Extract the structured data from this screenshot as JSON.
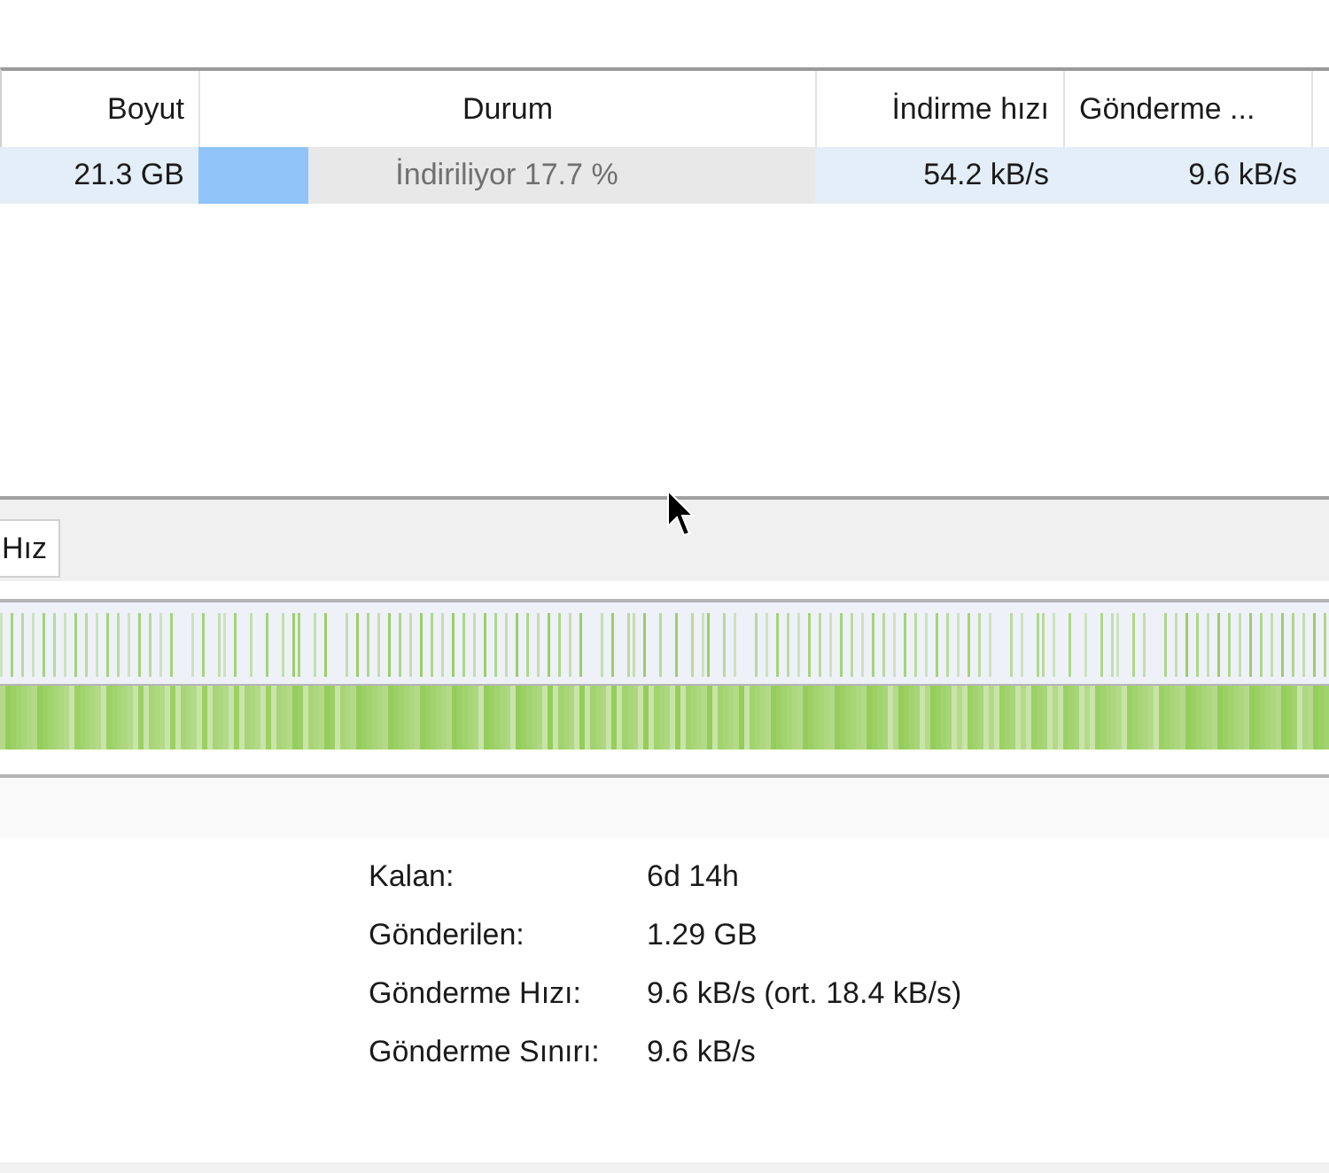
{
  "table": {
    "columns": [
      "Boyut",
      "Durum",
      "İndirme hızı",
      "Gönderme ..."
    ],
    "rows": [
      {
        "selected": true,
        "size": "21.3 GB",
        "status": "İndiriliyor 17.7 %",
        "level": 0.177,
        "download_speed": "54.2 kB/s",
        "upload_speed": "9.6 kB/s"
      }
    ]
  },
  "tabs": [
    {
      "label": "Hız",
      "selected": true
    }
  ],
  "details": [
    {
      "label": "Kalan:",
      "value": "6d 14h"
    },
    {
      "label": "Gönderilen:",
      "value": "1.29 GB"
    },
    {
      "label": "Gönderme Hızı:",
      "value": "9.6 kB/s (ort. 18.4 kB/s)"
    },
    {
      "label": "Gönderme Sınırı:",
      "value": "9.6 kB/s"
    }
  ]
}
